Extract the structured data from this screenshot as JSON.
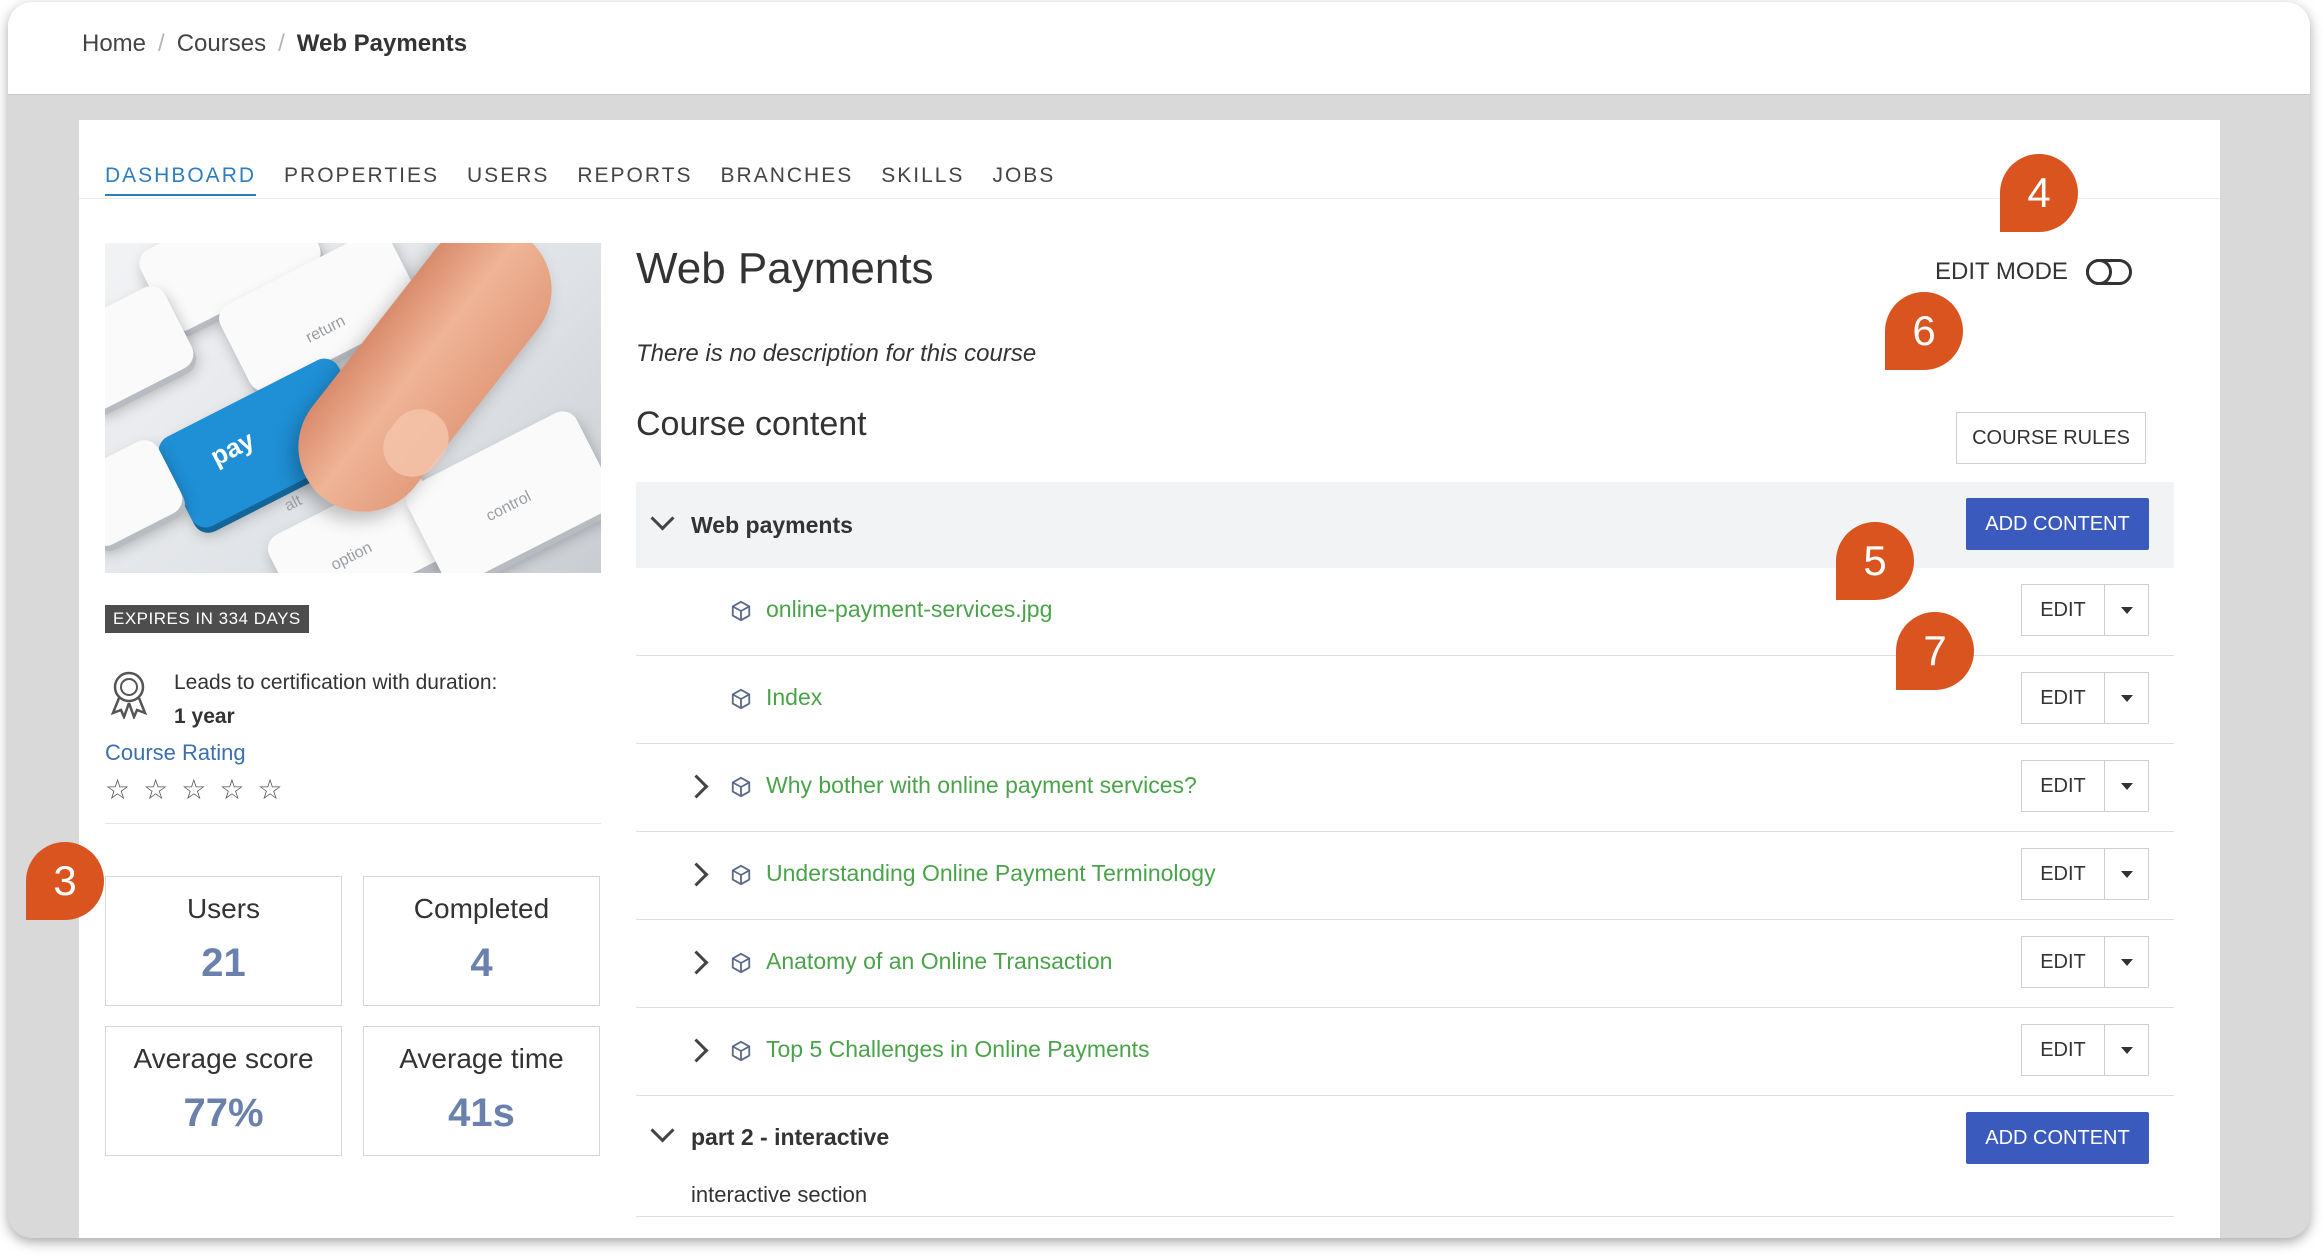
{
  "breadcrumb": {
    "home": "Home",
    "courses": "Courses",
    "current": "Web Payments",
    "separator": "/"
  },
  "tabs": [
    "DASHBOARD",
    "PROPERTIES",
    "USERS",
    "REPORTS",
    "BRANCHES",
    "SKILLS",
    "JOBS"
  ],
  "course_image": {
    "key_label": "pay",
    "key_return": "return",
    "key_control": "control",
    "key_option": "option",
    "key_alt": "alt"
  },
  "sidebar": {
    "expires": "EXPIRES IN 334 DAYS",
    "certification_text": "Leads to certification with duration:",
    "certification_duration": "1 year",
    "rating_label": "Course Rating",
    "stars": 5
  },
  "stats": {
    "users": {
      "label": "Users",
      "value": "21"
    },
    "completed": {
      "label": "Completed",
      "value": "4"
    },
    "average_score": {
      "label": "Average score",
      "value": "77%"
    },
    "average_time": {
      "label": "Average time",
      "value": "41s"
    }
  },
  "course": {
    "title": "Web Payments",
    "description": "There is no description for this course",
    "content_heading": "Course content"
  },
  "edit_mode_label": "EDIT MODE",
  "course_rules_label": "COURSE RULES",
  "add_content_label": "ADD CONTENT",
  "edit_label": "EDIT",
  "units": [
    {
      "title": "Web payments",
      "items": [
        {
          "name": "online-payment-services.jpg",
          "expandable": false
        },
        {
          "name": "Index",
          "expandable": false
        },
        {
          "name": "Why bother with online payment services?",
          "expandable": true
        },
        {
          "name": "Understanding Online Payment Terminology",
          "expandable": true
        },
        {
          "name": "Anatomy of an Online Transaction",
          "expandable": true
        },
        {
          "name": "Top 5 Challenges in Online Payments",
          "expandable": true
        }
      ]
    },
    {
      "title": "part 2 - interactive",
      "subtitle": "interactive section"
    }
  ],
  "callouts": [
    "3",
    "4",
    "5",
    "6",
    "7"
  ],
  "colors": {
    "accent": "#2e7dbf",
    "primary_button": "#3a5bbd",
    "link_green": "#4aa34a",
    "callout": "#d9541e",
    "stat_value": "#6a80ad"
  }
}
